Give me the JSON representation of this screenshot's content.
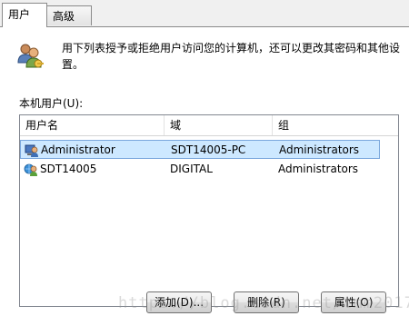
{
  "tabs": [
    {
      "label": "用户",
      "active": true
    },
    {
      "label": "高级",
      "active": false
    }
  ],
  "description": "用下列表授予或拒绝用户访问您的计算机，还可以更改其密码和其他设置。",
  "description_icon": "users-icon",
  "list_label": "本机用户(U):",
  "columns": [
    "用户名",
    "域",
    "组"
  ],
  "rows": [
    {
      "name": "Administrator",
      "domain": "SDT14005-PC",
      "group": "Administrators",
      "selected": true,
      "icon": "admin-user-icon"
    },
    {
      "name": "SDT14005",
      "domain": "DIGITAL",
      "group": "Administrators",
      "selected": false,
      "icon": "domain-user-icon"
    }
  ],
  "buttons": {
    "add": "添加(D)...",
    "remove": "删除(R)",
    "properties": "属性(O)"
  },
  "watermark": "https://blog.csdn.net/tmm2017",
  "colors": {
    "selection_bg": "#cde8ff",
    "selection_border": "#7aa7dc"
  }
}
